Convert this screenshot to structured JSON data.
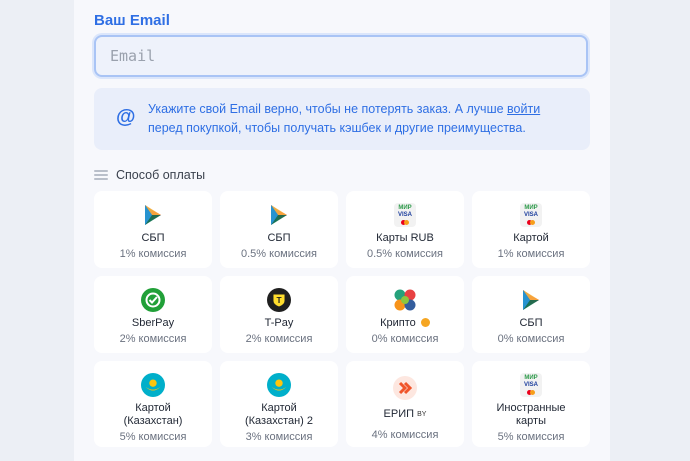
{
  "email": {
    "label": "Ваш Email",
    "placeholder": "Email",
    "value": ""
  },
  "info": {
    "text_before": "Укажите свой Email верно, чтобы не потерять заказ. А лучше ",
    "link": "войти",
    "text_after": " перед покупкой, чтобы получать кэшбек и другие преимущества."
  },
  "payment": {
    "heading": "Способ оплаты",
    "methods": [
      {
        "name": "СБП",
        "fee": "1% комиссия",
        "icon": "sbp-icon"
      },
      {
        "name": "СБП",
        "fee": "0.5% комиссия",
        "icon": "sbp-icon"
      },
      {
        "name": "Карты RUB",
        "fee": "0.5% комиссия",
        "icon": "mir-visa-icon"
      },
      {
        "name": "Картой",
        "fee": "1% комиссия",
        "icon": "mir-visa-icon"
      },
      {
        "name": "SberPay",
        "fee": "2% комиссия",
        "icon": "sberpay-icon"
      },
      {
        "name": "T-Pay",
        "fee": "2% комиссия",
        "icon": "tpay-icon"
      },
      {
        "name": "Крипто",
        "fee": "0% комиссия",
        "icon": "crypto-icon"
      },
      {
        "name": "СБП",
        "fee": "0% комиссия",
        "icon": "sbp-icon"
      },
      {
        "name": "Картой (Казахстан)",
        "fee": "5% комиссия",
        "icon": "kazakhstan-flag-icon"
      },
      {
        "name": "Картой (Казахстан) 2",
        "fee": "3% комиссия",
        "icon": "kazakhstan-flag-icon"
      },
      {
        "name": "ЕРИП",
        "badge": "BY",
        "fee": "4% комиссия",
        "icon": "erip-icon"
      },
      {
        "name": "Иностранные карты",
        "fee": "5% комиссия",
        "icon": "mir-visa-icon"
      }
    ]
  },
  "mir_text": "МИР",
  "visa_text": "VISA",
  "tpay_glyph": "T"
}
